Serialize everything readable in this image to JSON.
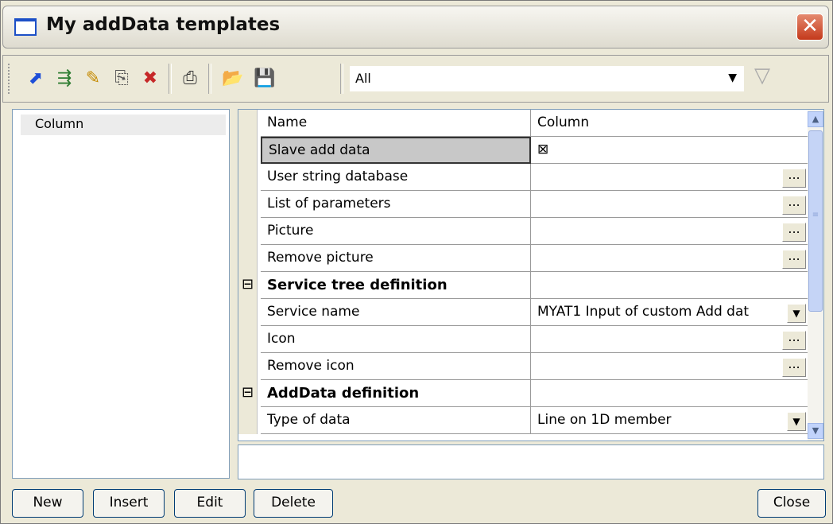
{
  "window": {
    "title": "My addData templates"
  },
  "toolbar": {
    "icons": [
      "new-template-icon",
      "add-row-icon",
      "edit-pencil-icon",
      "copy-icon",
      "delete-icon",
      "print-icon",
      "open-folder-icon",
      "save-icon"
    ],
    "filter_value": "All"
  },
  "left_panel": {
    "items": [
      {
        "label": "Column"
      }
    ]
  },
  "properties": {
    "rows": [
      {
        "name": "Name",
        "value": "Column",
        "control": ""
      },
      {
        "name": "Slave add data",
        "value": "⊠",
        "control": "",
        "selected": true
      },
      {
        "name": "User string database",
        "value": "",
        "control": "ellipsis"
      },
      {
        "name": "List of parameters",
        "value": "",
        "control": "ellipsis"
      },
      {
        "name": "Picture",
        "value": "",
        "control": "ellipsis"
      },
      {
        "name": "Remove picture",
        "value": "",
        "control": "ellipsis"
      },
      {
        "name": "Service tree definition",
        "value": "",
        "control": "",
        "section": true
      },
      {
        "name": "Service name",
        "value": "MYAT1 Input of custom Add dat",
        "control": "dropdown"
      },
      {
        "name": "Icon",
        "value": "",
        "control": "ellipsis"
      },
      {
        "name": "Remove icon",
        "value": "",
        "control": "ellipsis"
      },
      {
        "name": "AddData definition",
        "value": "",
        "control": "",
        "section": true
      },
      {
        "name": "Type of data",
        "value": "Line on 1D member",
        "control": "dropdown"
      }
    ],
    "ellipsis_label": "...",
    "collapse_glyph": "⊟"
  },
  "buttons": {
    "new": "New",
    "insert": "Insert",
    "edit": "Edit",
    "delete": "Delete",
    "close": "Close"
  }
}
